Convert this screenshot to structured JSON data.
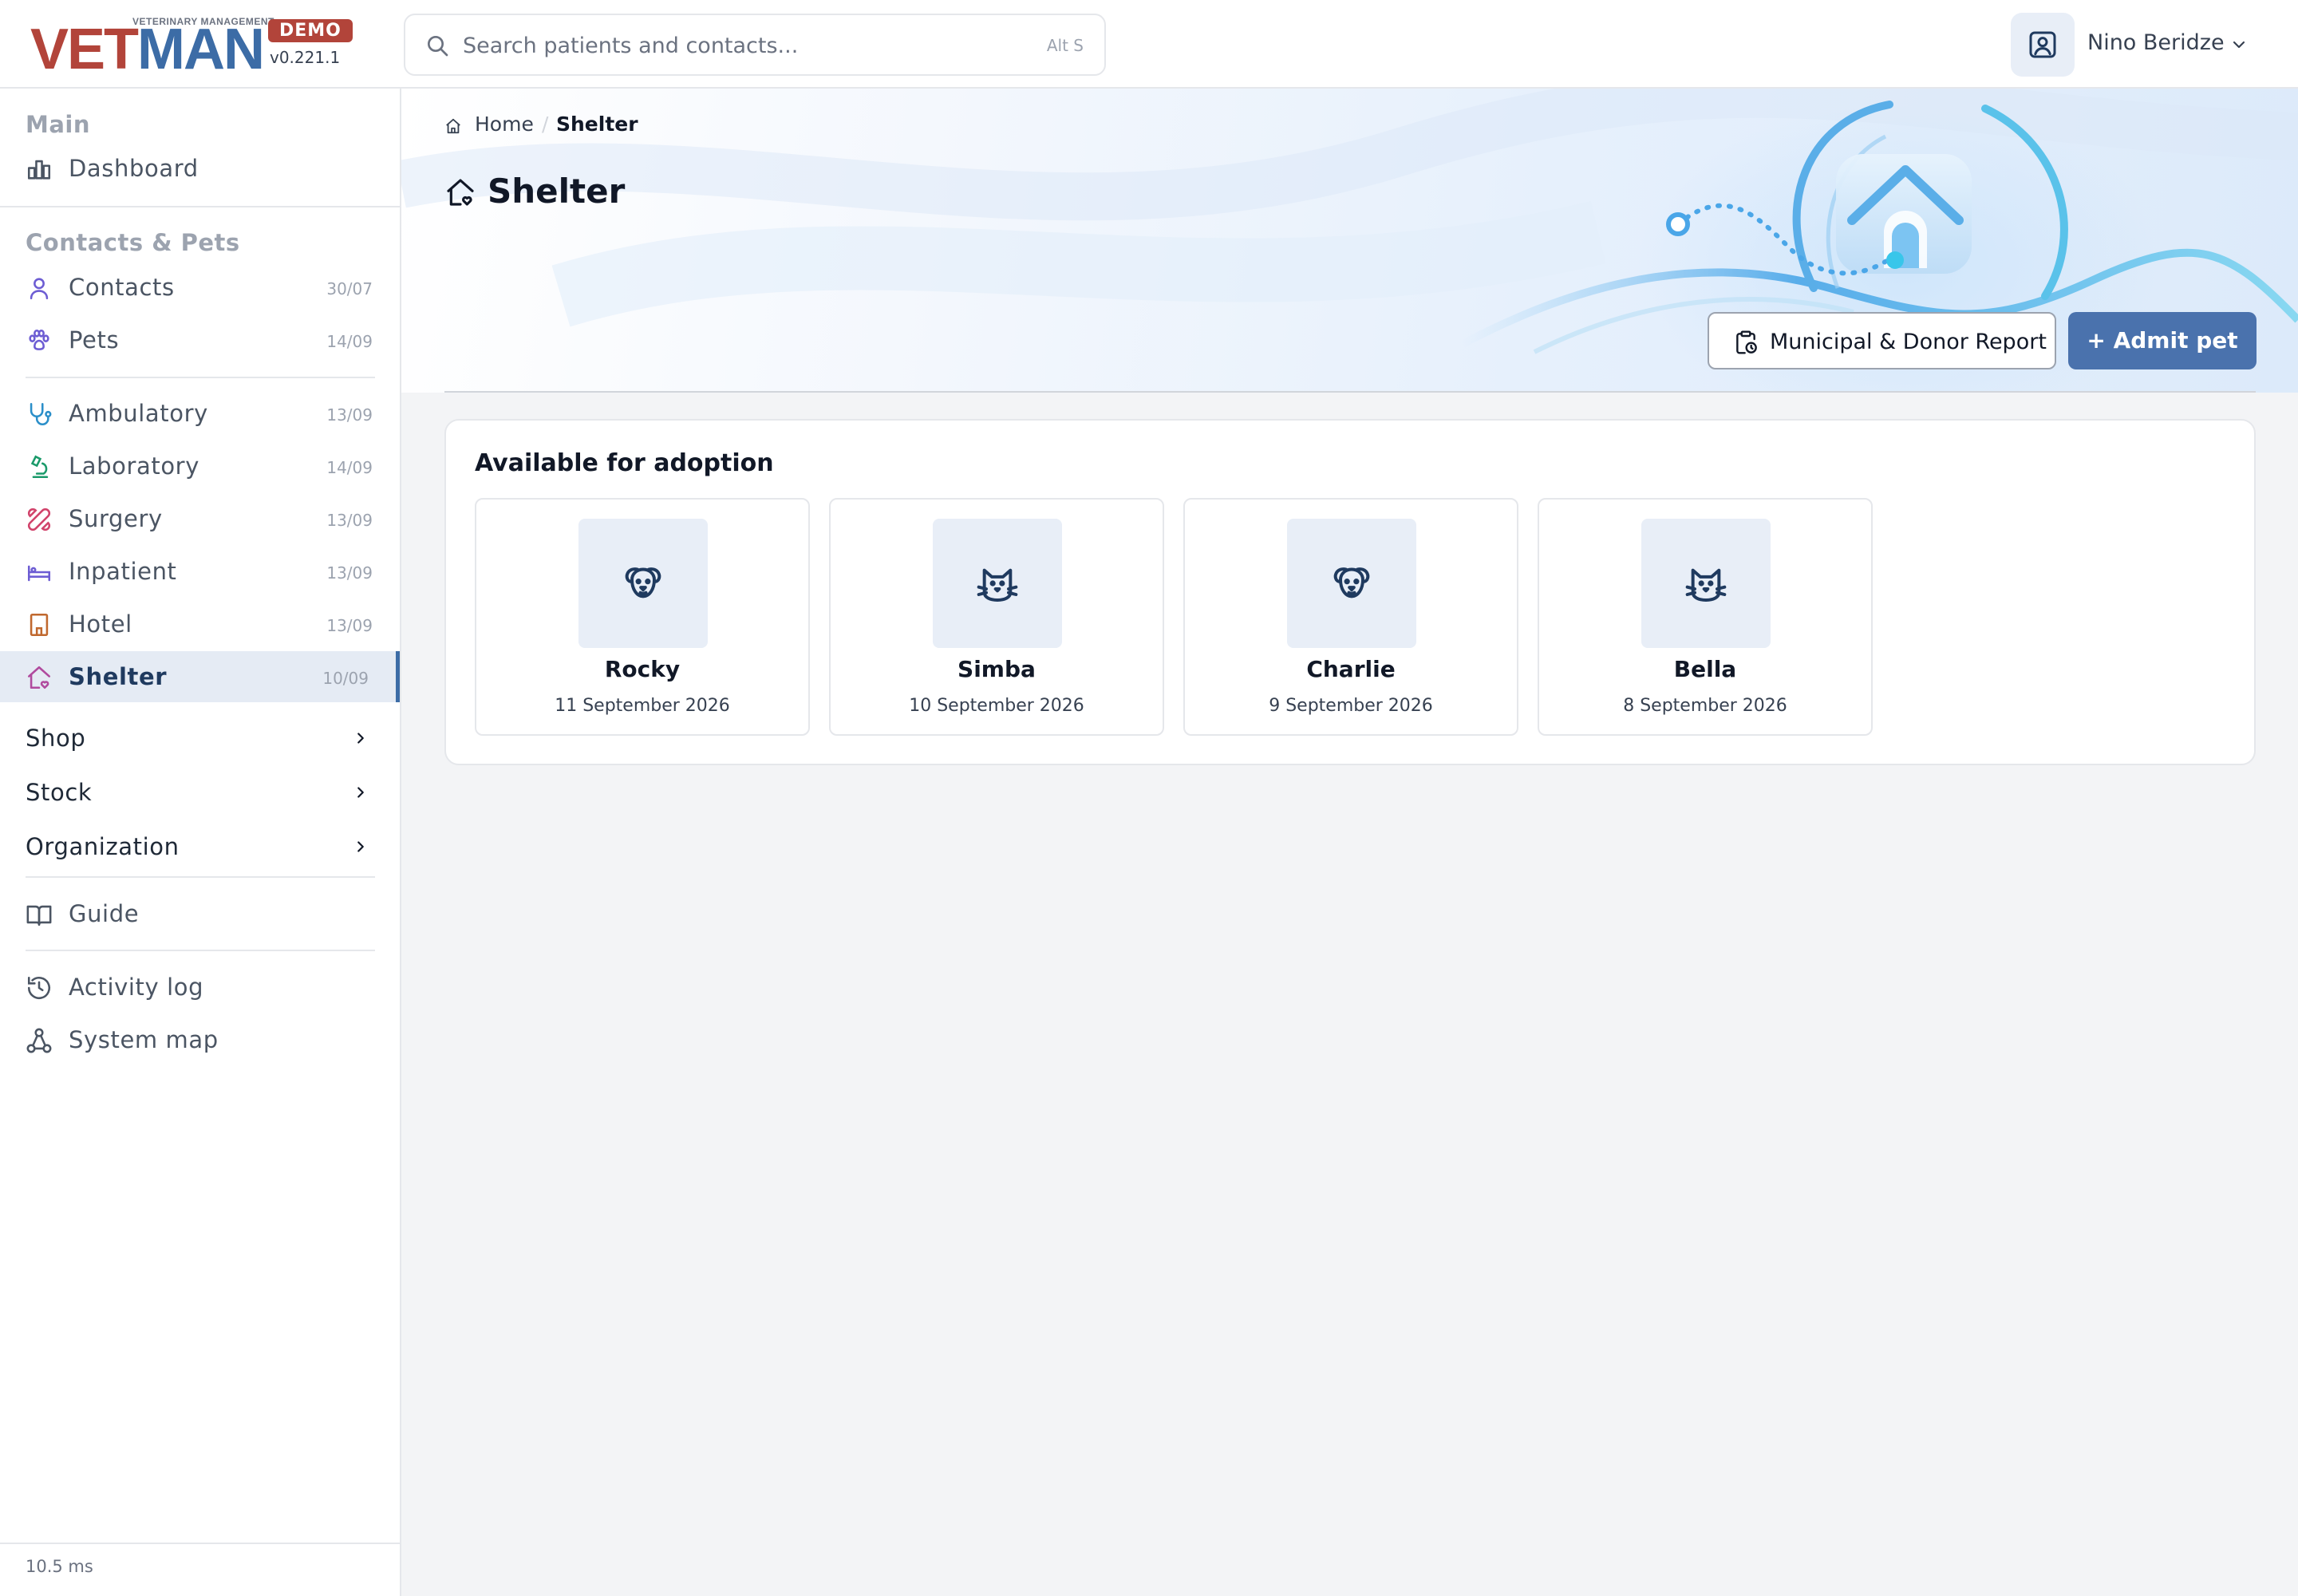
{
  "app": {
    "logo_subtitle": "VETERINARY MANAGEMENT",
    "logo_vet": "VET",
    "logo_man": "MAN",
    "badge": "DEMO",
    "version": "v0.221.1"
  },
  "search": {
    "placeholder": "Search patients and contacts...",
    "value": "",
    "shortcut": "Alt S"
  },
  "user": {
    "name": "Nino Beridze"
  },
  "sidebar": {
    "main_title": "Main",
    "dashboard": "Dashboard",
    "contacts_title": "Contacts & Pets",
    "items": [
      {
        "label": "Contacts",
        "date": "30/07"
      },
      {
        "label": "Pets",
        "date": "14/09"
      },
      {
        "label": "Ambulatory",
        "date": "13/09"
      },
      {
        "label": "Laboratory",
        "date": "14/09"
      },
      {
        "label": "Surgery",
        "date": "13/09"
      },
      {
        "label": "Inpatient",
        "date": "13/09"
      },
      {
        "label": "Hotel",
        "date": "13/09"
      },
      {
        "label": "Shelter",
        "date": "10/09"
      }
    ],
    "groups": [
      "Shop",
      "Stock",
      "Organization"
    ],
    "guide": "Guide",
    "activity_log": "Activity log",
    "system_map": "System map",
    "footer": "10.5 ms"
  },
  "breadcrumb": {
    "home": "Home",
    "separator": "/",
    "current": "Shelter"
  },
  "page": {
    "title": "Shelter",
    "report_button": "Municipal & Donor Report",
    "admit_button": "+ Admit pet"
  },
  "adoption": {
    "title": "Available for adoption",
    "pets": [
      {
        "name": "Rocky",
        "date": "11 September 2026",
        "species_icon": "dog-icon"
      },
      {
        "name": "Simba",
        "date": "10 September 2026",
        "species_icon": "cat-icon"
      },
      {
        "name": "Charlie",
        "date": "9 September 2026",
        "species_icon": "dog-icon"
      },
      {
        "name": "Bella",
        "date": "8 September 2026",
        "species_icon": "cat-icon"
      }
    ]
  },
  "colors": {
    "brand_red": "#b2443a",
    "brand_blue": "#3c6ca6",
    "primary_button": "#4a72ad",
    "active_nav_bg": "#e5ebf4"
  }
}
